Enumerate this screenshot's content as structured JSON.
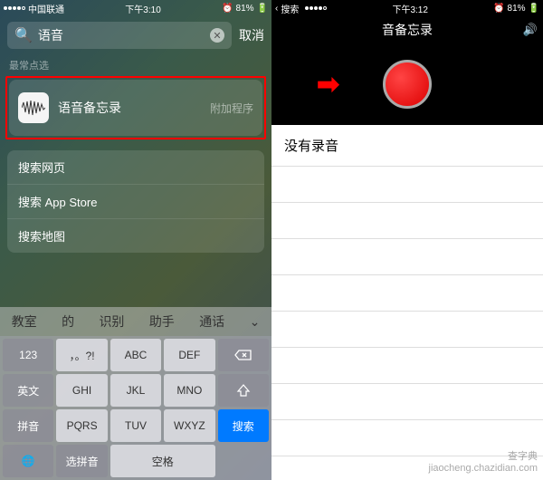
{
  "left": {
    "status": {
      "carrier": "中国联通",
      "time": "下午3:10",
      "battery": "81%"
    },
    "search": {
      "value": "语音",
      "cancel": "取消"
    },
    "section_label": "最常点选",
    "result": {
      "name": "语音备忘录",
      "tag": "附加程序"
    },
    "suggestions": [
      "搜索网页",
      "搜索 App Store",
      "搜索地图"
    ],
    "candidates": [
      "教室",
      "的",
      "识别",
      "助手",
      "通话"
    ],
    "keys": {
      "r1": [
        "123",
        "，。?!",
        "ABC",
        "DEF"
      ],
      "r2": [
        "英文",
        "GHI",
        "JKL",
        "MNO"
      ],
      "r3": [
        "拼音",
        "PQRS",
        "TUV",
        "WXYZ"
      ],
      "r4": [
        "选拼音",
        "空格"
      ],
      "backspace_icon": "backspace-icon",
      "caps_icon": "caps-icon",
      "search": "搜索",
      "globe_icon": "globe-icon"
    }
  },
  "right": {
    "status": {
      "back_label": "搜索",
      "time": "下午3:12",
      "battery": "81%"
    },
    "nav": {
      "title": "音备忘录"
    },
    "empty_message": "没有录音"
  },
  "watermark": {
    "line1": "查字典",
    "line2": "jiaocheng.chazidian.com"
  }
}
